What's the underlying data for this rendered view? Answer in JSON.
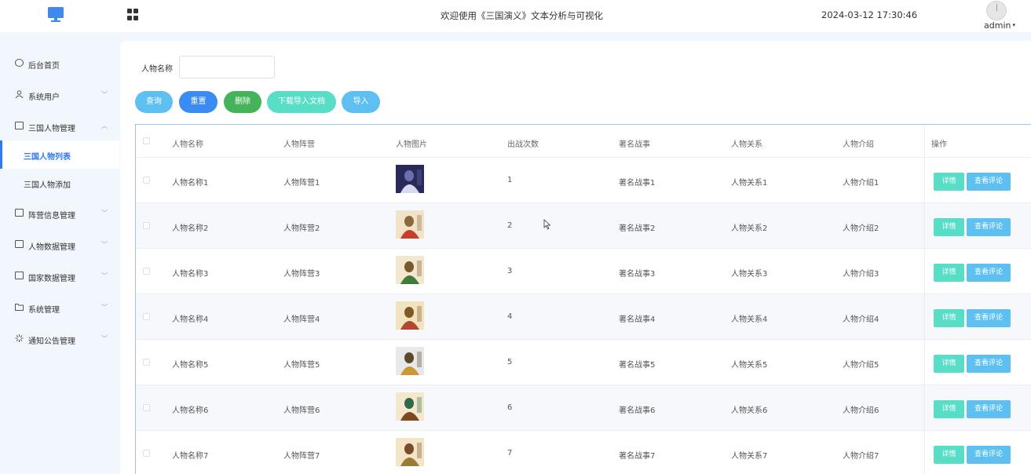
{
  "header": {
    "title": "欢迎使用《三国演义》文本分析与可视化",
    "datetime": "2024-03-12 17:30:46",
    "username": "admin",
    "caret": "▾"
  },
  "icons": {
    "logo": "monitor-icon",
    "apps": "grid-apps-icon",
    "cursor": "mouse-pointer-icon"
  },
  "sidebar": {
    "items": [
      {
        "label": "后台首页",
        "icon": "clock-icon",
        "chevron": ""
      },
      {
        "label": "系统用户",
        "icon": "user-icon",
        "chevron": "﹀"
      },
      {
        "label": "三国人物管理",
        "icon": "card-icon",
        "chevron": "︿"
      },
      {
        "label": "阵营信息管理",
        "icon": "card-icon",
        "chevron": "﹀"
      },
      {
        "label": "人物数据管理",
        "icon": "card-icon",
        "chevron": "﹀"
      },
      {
        "label": "国家数据管理",
        "icon": "card-icon",
        "chevron": "﹀"
      },
      {
        "label": "系统管理",
        "icon": "folder-icon",
        "chevron": "﹀"
      },
      {
        "label": "通知公告管理",
        "icon": "loading-icon",
        "chevron": "﹀"
      }
    ],
    "subitems": [
      {
        "label": "三国人物列表",
        "active": true
      },
      {
        "label": "三国人物添加",
        "active": false
      }
    ]
  },
  "search": {
    "label": "人物名称",
    "value": "",
    "placeholder": ""
  },
  "toolbar": {
    "query": "查询",
    "reset": "重置",
    "delete": "删除",
    "download": "下载导入文档",
    "import": "导入"
  },
  "table": {
    "columns": [
      "人物名称",
      "人物阵营",
      "人物图片",
      "出战次数",
      "著名战事",
      "人物关系",
      "人物介绍",
      "操作"
    ],
    "detail_label": "详情",
    "comment_label": "查看评论",
    "rows": [
      {
        "name": "人物名称1",
        "camp": "人物阵营1",
        "battles": "1",
        "war": "著名战事1",
        "relation": "人物关系1",
        "intro": "人物介绍1"
      },
      {
        "name": "人物名称2",
        "camp": "人物阵营2",
        "battles": "2",
        "war": "著名战事2",
        "relation": "人物关系2",
        "intro": "人物介绍2"
      },
      {
        "name": "人物名称3",
        "camp": "人物阵营3",
        "battles": "3",
        "war": "著名战事3",
        "relation": "人物关系3",
        "intro": "人物介绍3"
      },
      {
        "name": "人物名称4",
        "camp": "人物阵营4",
        "battles": "4",
        "war": "著名战事4",
        "relation": "人物关系4",
        "intro": "人物介绍4"
      },
      {
        "name": "人物名称5",
        "camp": "人物阵营5",
        "battles": "5",
        "war": "著名战事5",
        "relation": "人物关系5",
        "intro": "人物介绍5"
      },
      {
        "name": "人物名称6",
        "camp": "人物阵营6",
        "battles": "6",
        "war": "著名战事6",
        "relation": "人物关系6",
        "intro": "人物介绍6"
      },
      {
        "name": "人物名称7",
        "camp": "人物阵营7",
        "battles": "7",
        "war": "著名战事7",
        "relation": "人物关系7",
        "intro": "人物介绍7"
      }
    ]
  },
  "colors": {
    "accent": "#2f7bee",
    "query": "#5dc0f1",
    "reset": "#3a8bf2",
    "delete": "#44b35a",
    "download": "#58dec7",
    "sidebar_bg": "#f2f6fd"
  }
}
